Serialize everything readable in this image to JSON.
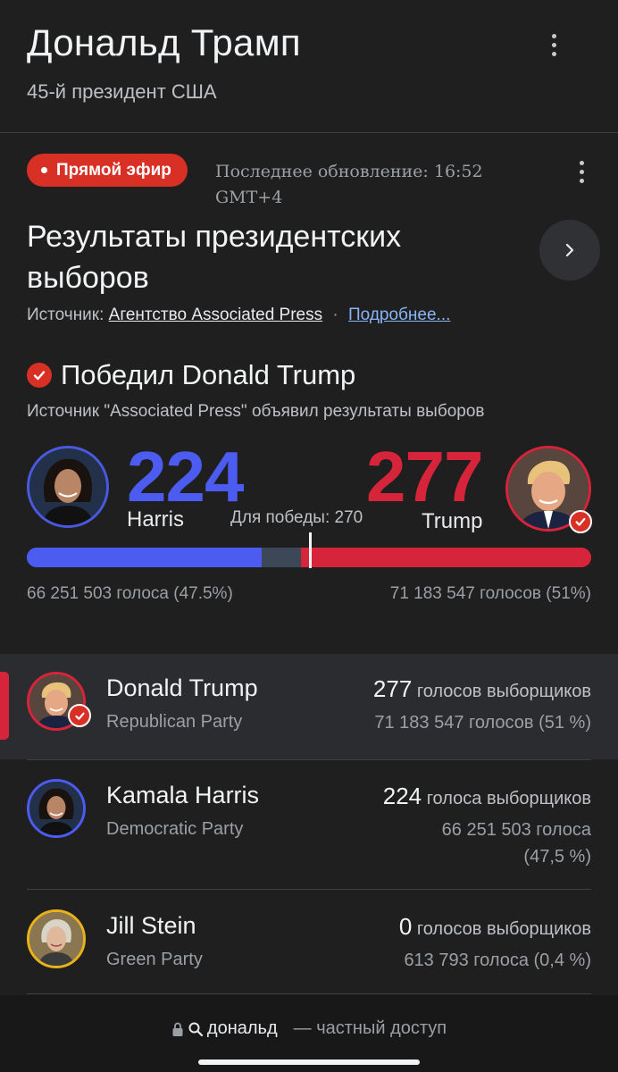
{
  "header": {
    "title": "Дональд Трамп",
    "subtitle": "45-й президент США"
  },
  "card": {
    "live_badge": "Прямой эфир",
    "updated": "Последнее обновление: 16:52 GMT+4",
    "title": "Результаты президентских выборов",
    "source_prefix": "Источник:",
    "source_link": "Агентство Associated Press",
    "separator": "·",
    "more_link": "Подробнее...",
    "winner": "Победил Donald Trump",
    "winner_desc": "Источник \"Associated Press\" объявил результаты выборов",
    "to_win": "Для победы: 270"
  },
  "tally": {
    "left": {
      "name": "Harris",
      "electoral": "224",
      "popular": "66 251 503 голоса (47.5%)",
      "color": "#4c5cf0"
    },
    "right": {
      "name": "Trump",
      "electoral": "277",
      "popular": "71 183 547 голосов (51%)",
      "color": "#d6243a"
    },
    "total_electoral": 538,
    "threshold": 270,
    "harris_ev": 224,
    "trump_ev": 277
  },
  "candidates": [
    {
      "name": "Donald Trump",
      "party": "Republican Party",
      "ev_num": "277",
      "ev_label": "голосов выборщиков",
      "popular": "71 183 547 голосов (51 %)",
      "color": "#d6243a",
      "winner": true
    },
    {
      "name": "Kamala Harris",
      "party": "Democratic Party",
      "ev_num": "224",
      "ev_label": "голоса выборщиков",
      "popular_line1": "66 251 503 голоса",
      "popular_line2": "(47,5 %)",
      "color": "#4c5cf0",
      "winner": false
    },
    {
      "name": "Jill Stein",
      "party": "Green Party",
      "ev_num": "0",
      "ev_label": "голосов выборщиков",
      "popular": "613 793 голоса (0,4 %)",
      "color": "#e8b21a",
      "winner": false
    }
  ],
  "address_bar": {
    "query": "дональд",
    "mode": "— частный доступ"
  },
  "icons": {
    "menu": "more-vert-icon",
    "chevron": "chevron-right-icon",
    "check": "check-icon",
    "lock": "lock-icon",
    "search": "search-icon"
  }
}
